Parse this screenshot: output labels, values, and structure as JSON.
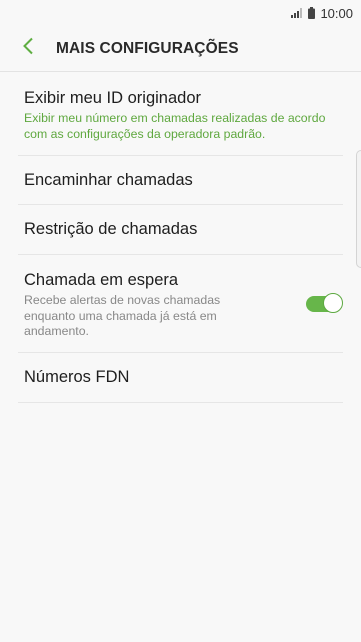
{
  "status_bar": {
    "time": "10:00",
    "signal_icon": "signal-icon",
    "battery_icon": "battery-icon"
  },
  "header": {
    "title": "MAIS CONFIGURAÇÕES",
    "back_icon": "chevron-left-icon"
  },
  "settings": {
    "caller_id": {
      "title": "Exibir meu ID originador",
      "subtitle": "Exibir meu número em chamadas realizadas de acordo com as configurações da operadora padrão."
    },
    "call_forwarding": {
      "title": "Encaminhar chamadas"
    },
    "call_barring": {
      "title": "Restrição de chamadas"
    },
    "call_waiting": {
      "title": "Chamada em espera",
      "subtitle": "Recebe alertas de novas chamadas enquanto uma chamada já está em andamento.",
      "enabled": true
    },
    "fdn": {
      "title": "Números FDN"
    }
  },
  "colors": {
    "accent": "#67b64a",
    "subtitle_accent": "#5fa83f",
    "background": "#f8f8f8"
  }
}
